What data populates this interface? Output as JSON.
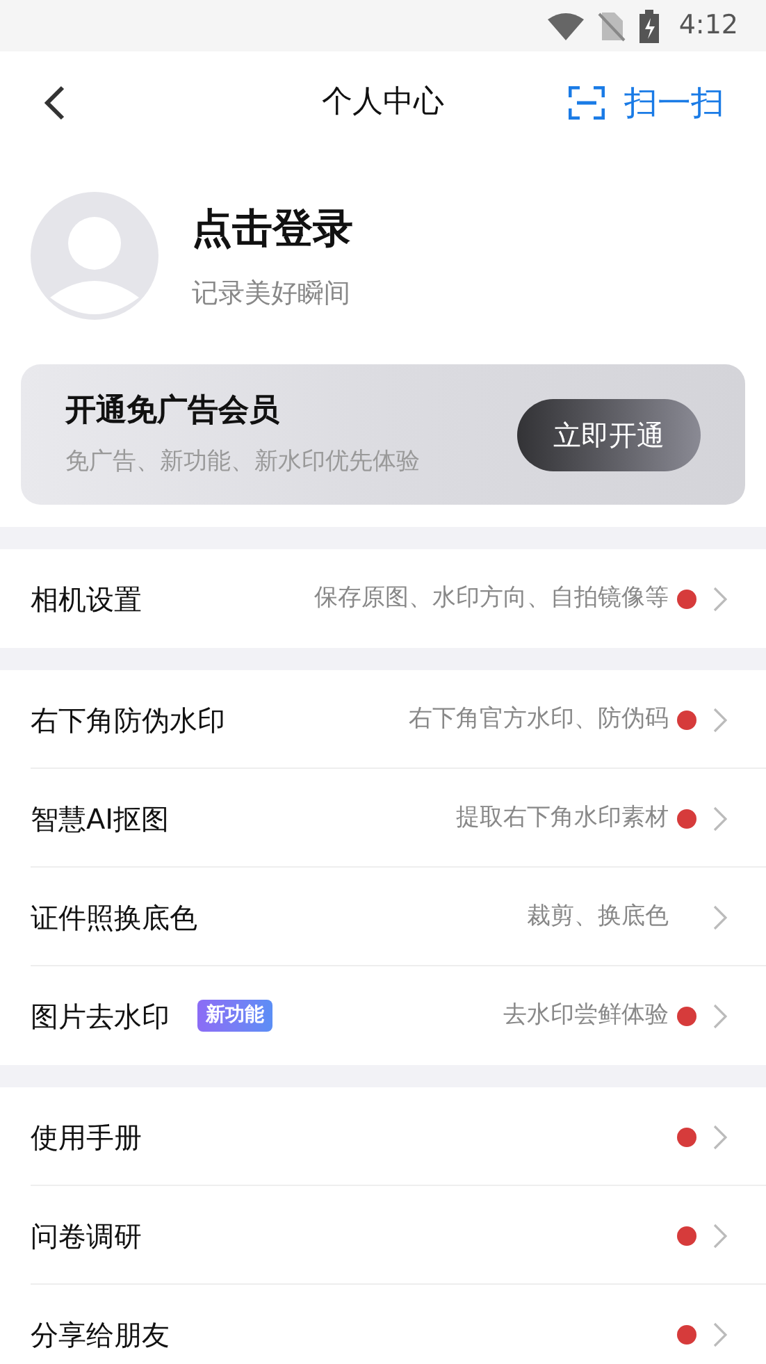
{
  "status_bar": {
    "time": "4:12"
  },
  "header": {
    "title": "个人中心",
    "scan_label": "扫一扫"
  },
  "profile": {
    "name": "点击登录",
    "subtitle": "记录美好瞬间"
  },
  "vip_banner": {
    "title": "开通免广告会员",
    "subtitle": "免广告、新功能、新水印优先体验",
    "button": "立即开通"
  },
  "sections": [
    {
      "items": [
        {
          "label": "相机设置",
          "detail": "保存原图、水印方向、自拍镜像等",
          "dot": true
        }
      ]
    },
    {
      "items": [
        {
          "label": "右下角防伪水印",
          "detail": "右下角官方水印、防伪码",
          "dot": true
        },
        {
          "label": "智慧AI抠图",
          "detail": "提取右下角水印素材",
          "dot": true
        },
        {
          "label": "证件照换底色",
          "detail": "裁剪、换底色",
          "dot": false
        },
        {
          "label": "图片去水印",
          "badge": "新功能",
          "detail": "去水印尝鲜体验",
          "dot": true
        }
      ]
    },
    {
      "items": [
        {
          "label": "使用手册",
          "dot": true
        },
        {
          "label": "问卷调研",
          "dot": true
        },
        {
          "label": "分享给朋友",
          "dot": true
        }
      ]
    }
  ]
}
